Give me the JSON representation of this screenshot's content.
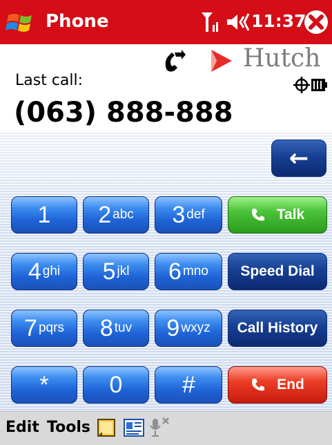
{
  "titlebar": {
    "title": "Phone",
    "time": "11:37"
  },
  "operator": {
    "name": "Hutch"
  },
  "last_call": {
    "label": "Last call:",
    "number": "(063) 888-888"
  },
  "keypad": {
    "backspace_symbol": "←",
    "keys": [
      {
        "digit": "1",
        "letters": ""
      },
      {
        "digit": "2",
        "letters": "abc"
      },
      {
        "digit": "3",
        "letters": "def"
      },
      {
        "digit": "4",
        "letters": "ghi"
      },
      {
        "digit": "5",
        "letters": "jkl"
      },
      {
        "digit": "6",
        "letters": "mno"
      },
      {
        "digit": "7",
        "letters": "pqrs"
      },
      {
        "digit": "8",
        "letters": "tuv"
      },
      {
        "digit": "9",
        "letters": "wxyz"
      },
      {
        "digit": "*",
        "letters": ""
      },
      {
        "digit": "0",
        "letters": ""
      },
      {
        "digit": "#",
        "letters": ""
      }
    ],
    "talk_label": "Talk",
    "speed_dial_label": "Speed Dial",
    "call_history_label": "Call History",
    "end_label": "End"
  },
  "menubar": {
    "edit": "Edit",
    "tools": "Tools"
  },
  "colors": {
    "titlebar": "#d40d17",
    "key_blue": "#1f63d6",
    "key_navy": "#173f93",
    "talk_green": "#2a9b1c",
    "end_red": "#c71c0e"
  }
}
